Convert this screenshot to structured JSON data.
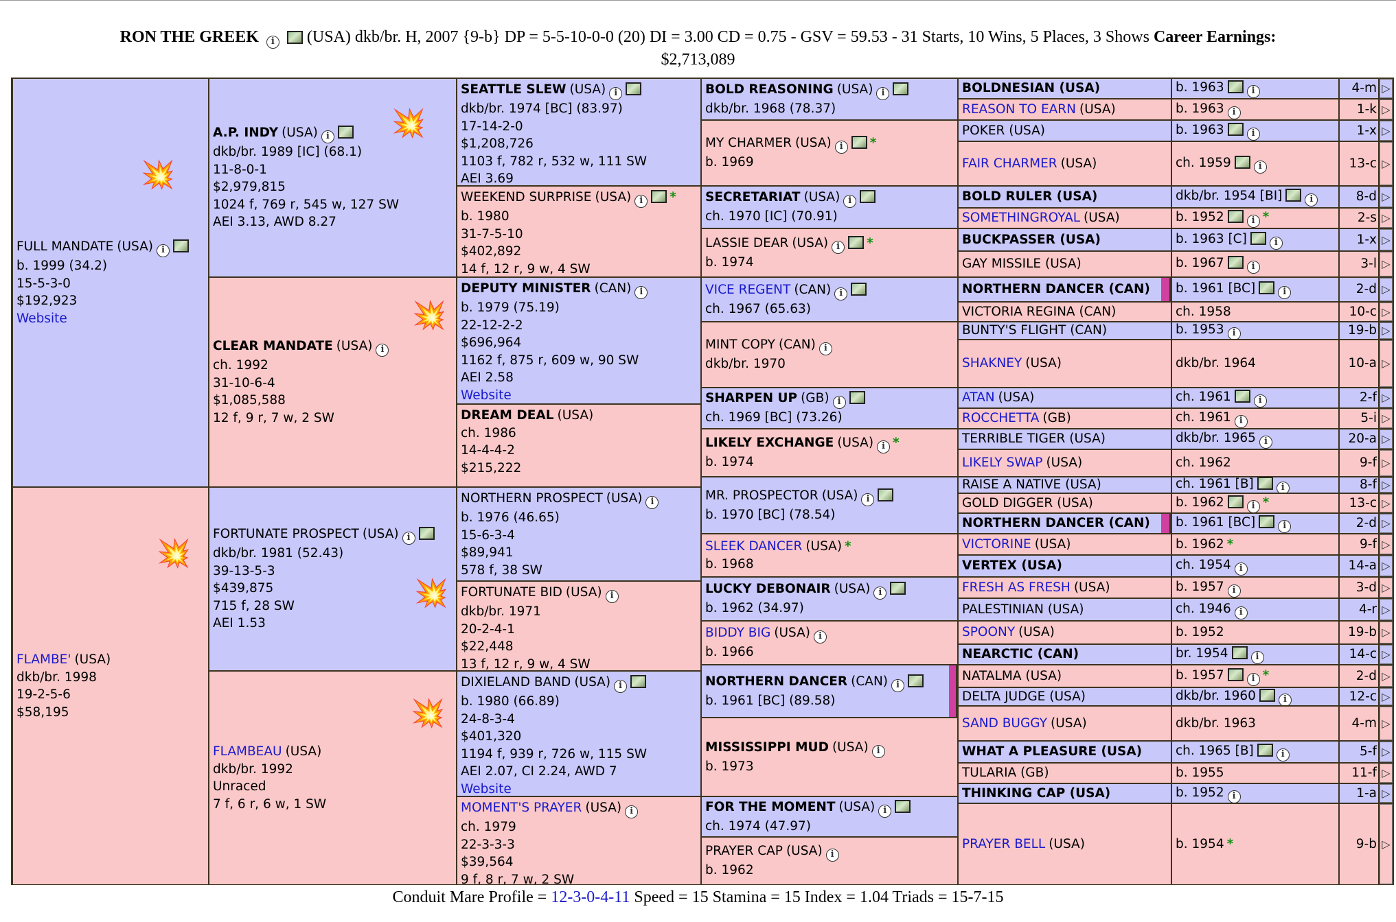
{
  "header": {
    "horse_name": "RON THE GREEK",
    "summary": "(USA) dkb/br. H, 2007 {9-b} DP = 5-5-10-0-0 (20) DI = 3.00   CD = 0.75 - GSV = 59.53 - 31 Starts, 10 Wins, 5 Places, 3 Shows",
    "earnings_label": "Career Earnings:",
    "earnings_value": "$2,713,089"
  },
  "footer": {
    "cmp_label": "Conduit Mare Profile =",
    "cmp_value": "12-3-0-4-11",
    "rest": "Speed = 15   Stamina = 15   Index = 1.04   Triads = 15-7-15"
  },
  "g1": [
    {
      "name": "FULL MANDATE",
      "country": "(USA)",
      "details": [
        "b. 1999 (34.2)",
        "15-5-3-0",
        "$192,923"
      ],
      "link": "Website",
      "sex": "m",
      "icons": "ip"
    },
    {
      "name": "FLAMBE'",
      "country": "(USA)",
      "details": [
        "dkb/br. 1998",
        "19-2-5-6",
        "$58,195"
      ],
      "sex": "f",
      "link_name": true
    }
  ],
  "g2": [
    {
      "name": "A.P. INDY",
      "country": "(USA)",
      "details": [
        "dkb/br. 1989 [IC] (68.1)",
        "11-8-0-1",
        "$2,979,815",
        "1024 f, 769 r, 545 w, 127 SW",
        "AEI 3.13, AWD 8.27"
      ],
      "sex": "m",
      "icons": "ip",
      "bold": true
    },
    {
      "name": "CLEAR MANDATE",
      "country": "(USA)",
      "details": [
        "ch. 1992",
        "31-10-6-4",
        "$1,085,588",
        "12 f, 9 r, 7 w, 2 SW"
      ],
      "sex": "f",
      "icons": "i",
      "bold": true
    },
    {
      "name": "FORTUNATE PROSPECT",
      "country": "(USA)",
      "details": [
        "dkb/br. 1981 (52.43)",
        "39-13-5-3",
        "$439,875",
        "715 f, 28 SW",
        "AEI 1.53"
      ],
      "sex": "m",
      "icons": "ip"
    },
    {
      "name": "FLAMBEAU",
      "country": "(USA)",
      "details": [
        "dkb/br. 1992",
        "Unraced",
        "7 f, 6 r, 6 w, 1 SW"
      ],
      "sex": "f",
      "link_name": true
    }
  ],
  "g3": [
    {
      "name": "SEATTLE SLEW",
      "country": "(USA)",
      "details": [
        "dkb/br. 1974 [BC] (83.97)",
        "17-14-2-0",
        "$1,208,726",
        "1103 f, 782 r, 532 w, 111 SW",
        "AEI 3.69"
      ],
      "sex": "m",
      "icons": "ip",
      "bold": true
    },
    {
      "name": "WEEKEND SURPRISE",
      "country": "(USA)",
      "details": [
        "b. 1980",
        "31-7-5-10",
        "$402,892",
        "14 f, 12 r, 9 w, 4 SW"
      ],
      "sex": "f",
      "icons": "ip",
      "star": true
    },
    {
      "name": "DEPUTY MINISTER",
      "country": "(CAN)",
      "details": [
        "b. 1979 (75.19)",
        "22-12-2-2",
        "$696,964",
        "1162 f, 875 r, 609 w, 90 SW",
        "AEI 2.58"
      ],
      "link": "Website",
      "sex": "m",
      "icons": "i",
      "bold": true
    },
    {
      "name": "DREAM DEAL",
      "country": "(USA)",
      "details": [
        "ch. 1986",
        "14-4-4-2",
        "$215,222"
      ],
      "sex": "f",
      "bold": true
    },
    {
      "name": "NORTHERN PROSPECT",
      "country": "(USA)",
      "details": [
        "b. 1976 (46.65)",
        "15-6-3-4",
        "$89,941",
        "578 f, 38 SW"
      ],
      "sex": "m",
      "icons": "i"
    },
    {
      "name": "FORTUNATE BID",
      "country": "(USA)",
      "details": [
        "dkb/br. 1971",
        "20-2-4-1",
        "$22,448",
        "13 f, 12 r, 9 w, 4 SW"
      ],
      "sex": "f",
      "icons": "i"
    },
    {
      "name": "DIXIELAND BAND",
      "country": "(USA)",
      "details": [
        "b. 1980 (66.89)",
        "24-8-3-4",
        "$401,320",
        "1194 f, 939 r, 726 w, 115 SW",
        "AEI 2.07, CI 2.24, AWD 7"
      ],
      "link": "Website",
      "sex": "m",
      "icons": "ip"
    },
    {
      "name": "MOMENT'S PRAYER",
      "country": "(USA)",
      "details": [
        "ch. 1979",
        "22-3-3-3",
        "$39,564",
        "9 f, 8 r, 7 w, 2 SW"
      ],
      "sex": "f",
      "icons": "i",
      "link_name": true
    }
  ],
  "g4": [
    {
      "name": "BOLD REASONING",
      "country": "(USA)",
      "details": [
        "dkb/br. 1968 (78.37)"
      ],
      "sex": "m",
      "icons": "ip",
      "bold": true
    },
    {
      "name": "MY CHARMER",
      "country": "(USA)",
      "details": [
        "b. 1969"
      ],
      "sex": "f",
      "icons": "ip",
      "star": true
    },
    {
      "name": "SECRETARIAT",
      "country": "(USA)",
      "details": [
        "ch. 1970 [IC] (70.91)"
      ],
      "sex": "m",
      "icons": "ip",
      "bold": true
    },
    {
      "name": "LASSIE DEAR",
      "country": "(USA)",
      "details": [
        "b. 1974"
      ],
      "sex": "f",
      "icons": "ip",
      "star": true
    },
    {
      "name": "VICE REGENT",
      "country": "(CAN)",
      "details": [
        "ch. 1967 (65.63)"
      ],
      "sex": "m",
      "icons": "ip",
      "link_name": true
    },
    {
      "name": "MINT COPY",
      "country": "(CAN)",
      "details": [
        "dkb/br. 1970"
      ],
      "sex": "f",
      "icons": "i"
    },
    {
      "name": "SHARPEN UP",
      "country": "(GB)",
      "details": [
        "ch. 1969 [BC] (73.26)"
      ],
      "sex": "m",
      "icons": "ip",
      "bold": true
    },
    {
      "name": "LIKELY EXCHANGE",
      "country": "(USA)",
      "details": [
        "b. 1974"
      ],
      "sex": "f",
      "icons": "i",
      "star": true,
      "bold": true
    },
    {
      "name": "MR. PROSPECTOR",
      "country": "(USA)",
      "details": [
        "b. 1970 [BC] (78.54)"
      ],
      "sex": "m",
      "icons": "ip"
    },
    {
      "name": "SLEEK DANCER",
      "country": "(USA)",
      "details": [
        "b. 1968"
      ],
      "sex": "f",
      "star": true,
      "link_name": true
    },
    {
      "name": "LUCKY DEBONAIR",
      "country": "(USA)",
      "details": [
        "b. 1962 (34.97)"
      ],
      "sex": "m",
      "icons": "ip",
      "bold": true
    },
    {
      "name": "BIDDY BIG",
      "country": "(USA)",
      "details": [
        "b. 1966"
      ],
      "sex": "f",
      "icons": "i",
      "link_name": true
    },
    {
      "name": "NORTHERN DANCER",
      "country": "(CAN)",
      "details": [
        "b. 1961 [BC] (89.58)"
      ],
      "sex": "m",
      "icons": "ip",
      "bold": true,
      "mark": true
    },
    {
      "name": "MISSISSIPPI MUD",
      "country": "(USA)",
      "details": [
        "b. 1973"
      ],
      "sex": "f",
      "icons": "i",
      "bold": true
    },
    {
      "name": "FOR THE MOMENT",
      "country": "(USA)",
      "details": [
        "ch. 1974 (47.97)"
      ],
      "sex": "m",
      "icons": "ip",
      "bold": true
    },
    {
      "name": "PRAYER CAP",
      "country": "(USA)",
      "details": [
        "b. 1962"
      ],
      "sex": "f",
      "icons": "i"
    }
  ],
  "g5": [
    {
      "name": "BOLDNESIAN (USA)",
      "info": "b. 1963",
      "icons": "pi",
      "sex": "m",
      "bold": true,
      "arr": "4-m"
    },
    {
      "name": "REASON TO EARN",
      "country": "(USA)",
      "info": "b. 1963",
      "icons": "i",
      "sex": "f",
      "link_name": true,
      "arr": "1-k"
    },
    {
      "name": "POKER (USA)",
      "info": "b. 1963",
      "icons": "pi",
      "sex": "m",
      "arr": "1-x"
    },
    {
      "name": "FAIR CHARMER",
      "country": "(USA)",
      "info": "ch. 1959",
      "icons": "pi",
      "sex": "f",
      "link_name": true,
      "arr": "13-c"
    },
    {
      "name": "BOLD RULER (USA)",
      "info": "dkb/br. 1954 [BI]",
      "icons": "pi",
      "sex": "m",
      "bold": true,
      "arr": "8-d"
    },
    {
      "name": "SOMETHINGROYAL",
      "country": "(USA)",
      "info": "b. 1952",
      "icons": "pi",
      "star": true,
      "sex": "f",
      "link_name": true,
      "arr": "2-s"
    },
    {
      "name": "BUCKPASSER (USA)",
      "info": "b. 1963 [C]",
      "icons": "pi",
      "sex": "m",
      "bold": true,
      "arr": "1-x"
    },
    {
      "name": "GAY MISSILE (USA)",
      "info": "b. 1967",
      "icons": "pi",
      "sex": "f",
      "arr": "3-l"
    },
    {
      "name": "NORTHERN DANCER (CAN)",
      "info": "b. 1961 [BC]",
      "icons": "pi",
      "sex": "m",
      "bold": true,
      "mark": true,
      "arr": "2-d"
    },
    {
      "name": "VICTORIA REGINA (CAN)",
      "info": "ch. 1958",
      "icons": "",
      "sex": "f",
      "arr": "10-c"
    },
    {
      "name": "BUNTY'S FLIGHT (CAN)",
      "info": "b. 1953",
      "icons": "i",
      "sex": "m",
      "arr": "19-b"
    },
    {
      "name": "SHAKNEY",
      "country": "(USA)",
      "info": "dkb/br. 1964",
      "icons": "",
      "sex": "f",
      "link_name": true,
      "arr": "10-a"
    },
    {
      "name": "ATAN",
      "country": "(USA)",
      "info": "ch. 1961",
      "icons": "pi",
      "sex": "m",
      "link_name": true,
      "arr": "2-f"
    },
    {
      "name": "ROCCHETTA",
      "country": "(GB)",
      "info": "ch. 1961",
      "icons": "i",
      "sex": "f",
      "link_name": true,
      "arr": "5-i"
    },
    {
      "name": "TERRIBLE TIGER (USA)",
      "info": "dkb/br. 1965",
      "icons": "i",
      "sex": "m",
      "arr": "20-a"
    },
    {
      "name": "LIKELY SWAP",
      "country": "(USA)",
      "info": "ch. 1962",
      "icons": "",
      "sex": "f",
      "link_name": true,
      "arr": "9-f"
    },
    {
      "name": "RAISE A NATIVE (USA)",
      "info": "ch. 1961 [B]",
      "icons": "pi",
      "sex": "m",
      "arr": "8-f"
    },
    {
      "name": "GOLD DIGGER (USA)",
      "info": "b. 1962",
      "icons": "pi",
      "star": true,
      "sex": "f",
      "arr": "13-c"
    },
    {
      "name": "NORTHERN DANCER (CAN)",
      "info": "b. 1961 [BC]",
      "icons": "pi",
      "sex": "m",
      "bold": true,
      "mark": true,
      "arr": "2-d"
    },
    {
      "name": "VICTORINE",
      "country": "(USA)",
      "info": "b. 1962",
      "icons": "",
      "star": true,
      "sex": "f",
      "link_name": true,
      "arr": "9-f"
    },
    {
      "name": "VERTEX (USA)",
      "info": "ch. 1954",
      "icons": "i",
      "sex": "m",
      "bold": true,
      "arr": "14-a"
    },
    {
      "name": "FRESH AS FRESH",
      "country": "(USA)",
      "info": "b. 1957",
      "icons": "i",
      "sex": "f",
      "link_name": true,
      "arr": "3-d"
    },
    {
      "name": "PALESTINIAN (USA)",
      "info": "ch. 1946",
      "icons": "i",
      "sex": "m",
      "arr": "4-r"
    },
    {
      "name": "SPOONY",
      "country": "(USA)",
      "info": "b. 1952",
      "icons": "",
      "sex": "f",
      "link_name": true,
      "arr": "19-b"
    },
    {
      "name": "NEARCTIC (CAN)",
      "info": "br. 1954",
      "icons": "pi",
      "sex": "m",
      "bold": true,
      "arr": "14-c"
    },
    {
      "name": "NATALMA (USA)",
      "info": "b. 1957",
      "icons": "pi",
      "star": true,
      "sex": "f",
      "arr": "2-d"
    },
    {
      "name": "DELTA JUDGE (USA)",
      "info": "dkb/br. 1960",
      "icons": "pi",
      "sex": "m",
      "arr": "12-c"
    },
    {
      "name": "SAND BUGGY",
      "country": "(USA)",
      "info": "dkb/br. 1963",
      "icons": "",
      "sex": "f",
      "link_name": true,
      "arr": "4-m"
    },
    {
      "name": "WHAT A PLEASURE (USA)",
      "info": "ch. 1965 [B]",
      "icons": "pi",
      "sex": "m",
      "bold": true,
      "arr": "5-f"
    },
    {
      "name": "TULARIA (GB)",
      "info": "b. 1955",
      "icons": "",
      "sex": "f",
      "arr": "11-f"
    },
    {
      "name": "THINKING CAP (USA)",
      "info": "b. 1952",
      "icons": "i",
      "sex": "m",
      "bold": true,
      "arr": "1-a"
    },
    {
      "name": "PRAYER BELL",
      "country": "(USA)",
      "info": "b. 1954",
      "icons": "",
      "star": true,
      "sex": "f",
      "link_name": true,
      "arr": "9-b"
    }
  ],
  "colors": {
    "male_bg": "#c8c8fa",
    "female_bg": "#fac8c8",
    "link": "#1a1acc",
    "star": "#109010",
    "grid": "#3d3320"
  }
}
